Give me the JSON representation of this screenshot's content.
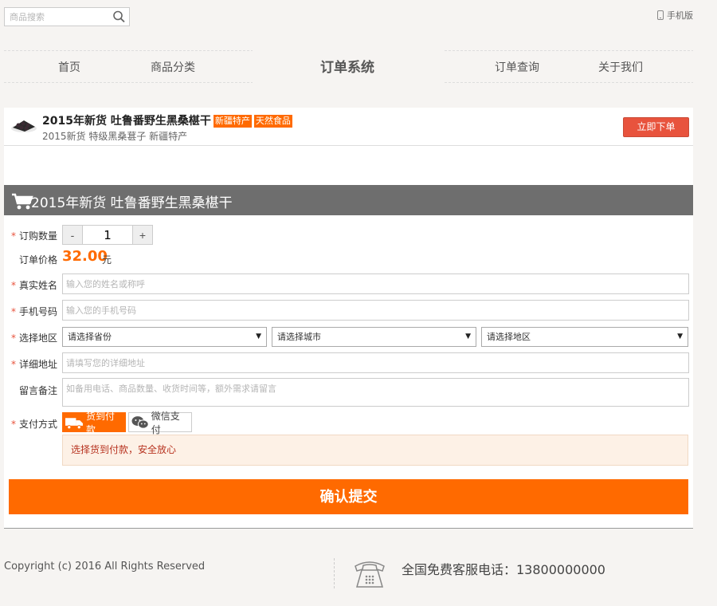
{
  "topbar": {
    "search_placeholder": "商品搜索",
    "mobile_label": "手机版"
  },
  "nav": {
    "home": "首页",
    "categories": "商品分类",
    "brand": "订单系统",
    "order_lookup": "订单查询",
    "about": "关于我们"
  },
  "product": {
    "title": "2015年新货 吐鲁番野生黑桑椹干",
    "tags": [
      "新疆特产",
      "天然食品"
    ],
    "subtitle": "2015新货 特级黑桑葚子 新疆特产",
    "order_now": "立即下单"
  },
  "form": {
    "header_title": "2015年新货 吐鲁番野生黑桑椹干",
    "quantity_label": "订购数量",
    "quantity_value": "1",
    "minus": "-",
    "plus": "+",
    "price_label": "订单价格",
    "price_value": "32.00",
    "price_unit": "元",
    "name_label": "真实姓名",
    "name_placeholder": "输入您的姓名或称呼",
    "phone_label": "手机号码",
    "phone_placeholder": "输入您的手机号码",
    "region_label": "选择地区",
    "province": "请选择省份",
    "city": "请选择城市",
    "district": "请选择地区",
    "address_label": "详细地址",
    "address_placeholder": "请填写您的详细地址",
    "note_label": "留言备注",
    "note_placeholder": "如备用电话、商品数量、收货时间等，额外需求请留言",
    "payment_label": "支付方式",
    "pay_cod": "货到付款",
    "pay_wechat": "微信支付",
    "notice": "选择货到付款，安全放心",
    "submit": "确认提交",
    "required_mark": "*"
  },
  "footer": {
    "copyright": "Copyright (c) 2016 All Rights Reserved",
    "hotline": "全国免费客服电话：13800000000"
  },
  "colors": {
    "accent": "#ff6a00",
    "order_button": "#e8533d",
    "header_bar": "#6e6e6e",
    "notice_bg": "#fdf1e6",
    "notice_text": "#b7321f"
  },
  "icons": [
    "search-icon",
    "phone-icon",
    "cart-icon",
    "truck-icon",
    "wechat-icon",
    "telephone-icon",
    "dropdown-arrow-icon"
  ]
}
